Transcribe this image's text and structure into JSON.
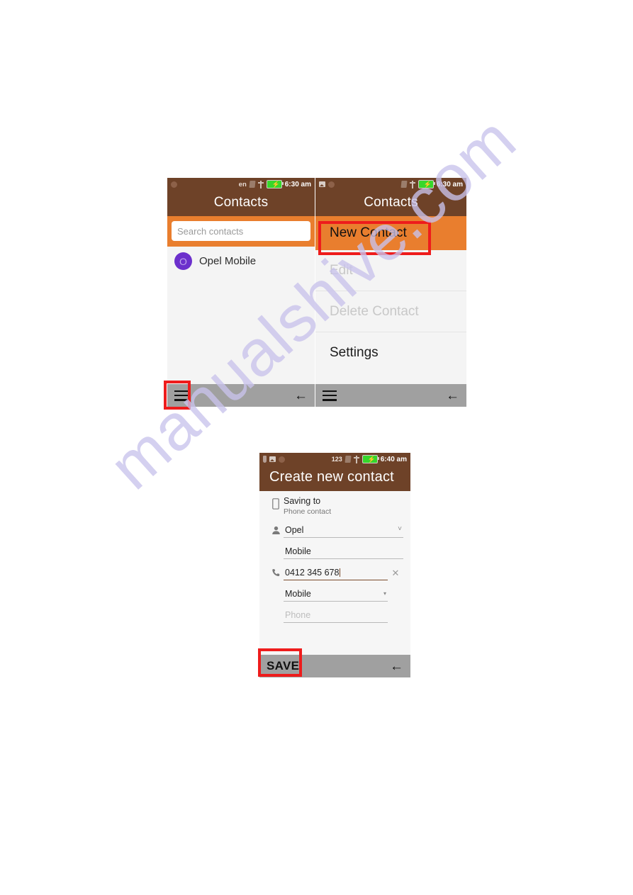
{
  "document": {
    "page_background": "#ffffff",
    "watermark": "manualshive.com",
    "watermark_color": "#c9c3ec"
  },
  "colors": {
    "header_brown": "#6e4228",
    "accent_orange": "#e97e2e",
    "nav_gray": "#a0a0a0",
    "highlight_red": "#ee1c1c",
    "avatar_purple": "#6c30cc",
    "battery_green": "#36d72b"
  },
  "screen_contacts_list": {
    "statusbar": {
      "left_icons": [
        "circle-icon"
      ],
      "right_icons": [
        "locale-en",
        "sim-card-icon",
        "usb-icon",
        "battery-charging-icon"
      ],
      "locale": "en",
      "time": "6:30 am"
    },
    "app_title": "Contacts",
    "search": {
      "placeholder": "Search contacts",
      "value": ""
    },
    "contacts": [
      {
        "initial": "O",
        "name": "Opel Mobile"
      }
    ],
    "navbar": {
      "menu_icon": "hamburger-menu-icon",
      "back_icon": "back-arrow-icon"
    }
  },
  "screen_contacts_menu": {
    "statusbar": {
      "left_icons": [
        "image-icon",
        "circle-icon"
      ],
      "right_icons": [
        "sim-card-icon",
        "usb-icon",
        "battery-charging-icon"
      ],
      "time": "6:30 am"
    },
    "app_title": "Contacts",
    "menu_items": [
      {
        "label": "New Contact",
        "state": "highlighted"
      },
      {
        "label": "Edit",
        "state": "disabled"
      },
      {
        "label": "Delete Contact",
        "state": "disabled"
      },
      {
        "label": "Settings",
        "state": "enabled"
      }
    ],
    "navbar": {
      "menu_icon": "hamburger-menu-icon",
      "back_icon": "back-arrow-icon"
    }
  },
  "screen_create_contact": {
    "statusbar": {
      "left_icons": [
        "pin-icon",
        "image-icon",
        "circle-icon"
      ],
      "right_icons": [
        "123",
        "sim-card-icon",
        "usb-icon",
        "battery-charging-icon"
      ],
      "input_mode": "123",
      "time": "6:40 am"
    },
    "app_title": "Create new contact",
    "saving_to": {
      "icon": "phone-device-icon",
      "label": "Saving to",
      "account": "Phone contact"
    },
    "fields": [
      {
        "icon": "person-icon",
        "value": "Opel",
        "placeholder": "",
        "state": "filled",
        "trailing": "chevron-down-icon"
      },
      {
        "icon": "",
        "value": "Mobile",
        "placeholder": "",
        "state": "filled",
        "trailing": ""
      },
      {
        "icon": "phone-icon",
        "value": "0412 345 678",
        "placeholder": "",
        "state": "active",
        "trailing": "clear-icon"
      },
      {
        "icon": "",
        "value": "Mobile",
        "placeholder": "",
        "state": "filled",
        "trailing": "dropdown-arrow-icon"
      },
      {
        "icon": "",
        "value": "",
        "placeholder": "Phone",
        "state": "placeholder",
        "trailing": ""
      }
    ],
    "navbar": {
      "save_label": "SAVE",
      "back_icon": "back-arrow-icon"
    }
  }
}
